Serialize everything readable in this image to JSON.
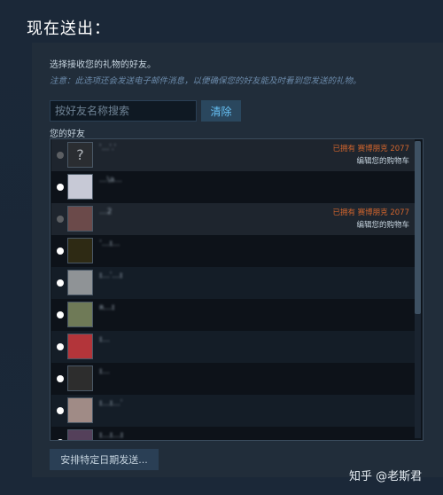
{
  "header": {
    "title": "现在送出："
  },
  "panel": {
    "instruction": "选择接收您的礼物的好友。",
    "notice": "注意：此选项还会发送电子邮件消息，以便确保您的好友能及时看到您发送的礼物。"
  },
  "search": {
    "placeholder": "按好友名称搜索",
    "clear_label": "清除"
  },
  "friends": {
    "label": "您的好友",
    "items": [
      {
        "name": "ʾ...ˈ.ˈ",
        "owned_status": "已拥有 赛博朋克 2077",
        "edit_cart": "编辑您的购物车",
        "disabled": true,
        "avatar_icon": "question-mark-avatar",
        "avatar_color": "#2a2d31"
      },
      {
        "name": "...\\a...",
        "disabled": false,
        "avatar_color": "#c7c9d6"
      },
      {
        "name": "...2",
        "owned_status": "已拥有 赛博朋克 2077",
        "edit_cart": "编辑您的购物车",
        "disabled": true,
        "avatar_color": "#6b4a4a"
      },
      {
        "name": "ʼ...ɪ...",
        "disabled": false,
        "avatar_color": "#2e2a14"
      },
      {
        "name": "ɪ...ˈ...ɪ",
        "disabled": false,
        "avatar_color": "#8f9396"
      },
      {
        "name": "ʀ...ɪ",
        "disabled": false,
        "avatar_color": "#6f7a57"
      },
      {
        "name": "ɪ...",
        "disabled": false,
        "avatar_color": "#b3353a"
      },
      {
        "name": "ɪ...",
        "disabled": false,
        "avatar_color": "#2d2d2d"
      },
      {
        "name": "ɪ...ɪ...ˈ",
        "disabled": false,
        "avatar_color": "#a08b86"
      },
      {
        "name": "ɪ...ɪ...ɪ",
        "disabled": false,
        "avatar_color": "#54405a"
      }
    ]
  },
  "schedule_button": {
    "label": "安排特定日期发送..."
  },
  "watermark": {
    "text": "知乎 @老斯君"
  },
  "colors": {
    "background": "#1b2838",
    "accent": "#66c0f4",
    "owned": "#d2652d"
  }
}
